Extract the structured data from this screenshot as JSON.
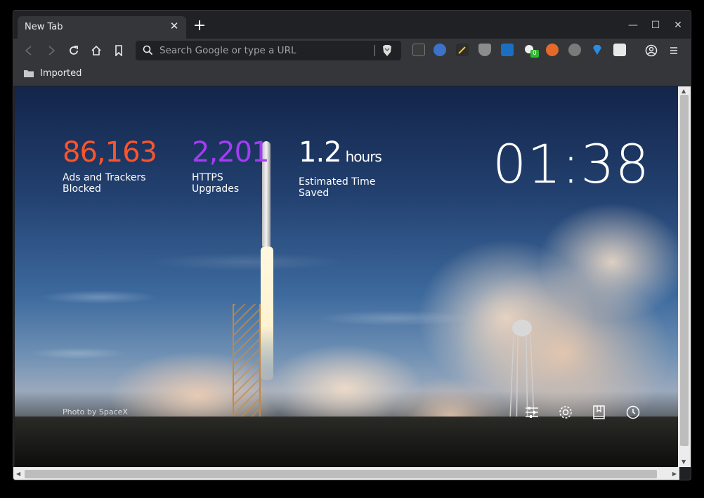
{
  "tab": {
    "title": "New Tab",
    "close": "✕"
  },
  "newtab": "+",
  "window_controls": {
    "minimize": "—",
    "maximize": "☐",
    "close": "✕"
  },
  "omnibox": {
    "placeholder": "Search Google or type a URL"
  },
  "bookmarks": {
    "items": [
      {
        "label": "Imported"
      }
    ]
  },
  "extensions": {
    "badge_count": "0"
  },
  "stats": {
    "ads": {
      "value": "86,163",
      "label": "Ads and Trackers Blocked",
      "color": "#fb542b"
    },
    "https": {
      "value": "2,201",
      "label": "HTTPS Upgrades",
      "color": "#a33cf5"
    },
    "time": {
      "value": "1.2",
      "unit": "hours",
      "label": "Estimated Time Saved",
      "color": "#ffffff"
    }
  },
  "clock": "01:38",
  "photo_credit": "Photo by SpaceX"
}
